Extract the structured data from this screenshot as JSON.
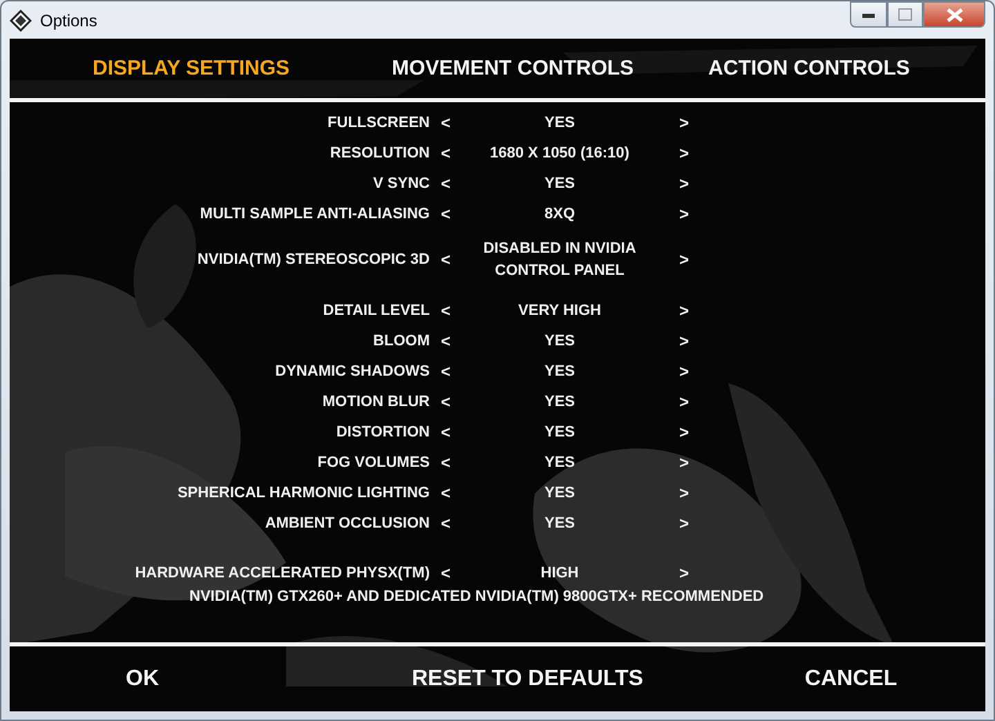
{
  "window": {
    "title": "Options"
  },
  "tabs": [
    {
      "label": "DISPLAY SETTINGS",
      "selected": true
    },
    {
      "label": "MOVEMENT CONTROLS",
      "selected": false
    },
    {
      "label": "ACTION CONTROLS",
      "selected": false
    }
  ],
  "settings": [
    {
      "label": "FULLSCREEN",
      "prev": "<",
      "value": "YES",
      "next": ">"
    },
    {
      "label": "RESOLUTION",
      "prev": "<",
      "value": "1680 X 1050 (16:10)",
      "next": ">"
    },
    {
      "label": "V SYNC",
      "prev": "<",
      "value": "YES",
      "next": ">"
    },
    {
      "label": "MULTI SAMPLE ANTI-ALIASING",
      "prev": "<",
      "value": "8XQ",
      "next": ">"
    },
    {
      "label": "NVIDIA(TM) STEREOSCOPIC 3D",
      "prev": "<",
      "value": "DISABLED IN NVIDIA CONTROL PANEL",
      "next": ">"
    },
    {
      "label": "DETAIL LEVEL",
      "prev": "<",
      "value": "VERY HIGH",
      "next": ">"
    },
    {
      "label": "BLOOM",
      "prev": "<",
      "value": "YES",
      "next": ">"
    },
    {
      "label": "DYNAMIC SHADOWS",
      "prev": "<",
      "value": "YES",
      "next": ">"
    },
    {
      "label": "MOTION BLUR",
      "prev": "<",
      "value": "YES",
      "next": ">"
    },
    {
      "label": "DISTORTION",
      "prev": "<",
      "value": "YES",
      "next": ">"
    },
    {
      "label": "FOG VOLUMES",
      "prev": "<",
      "value": "YES",
      "next": ">"
    },
    {
      "label": "SPHERICAL HARMONIC LIGHTING",
      "prev": "<",
      "value": "YES",
      "next": ">"
    },
    {
      "label": "AMBIENT OCCLUSION",
      "prev": "<",
      "value": "YES",
      "next": ">"
    }
  ],
  "physx": {
    "label": "HARDWARE ACCELERATED PHYSX(TM)",
    "prev": "<",
    "value": "HIGH",
    "next": ">",
    "note": "NVIDIA(TM) GTX260+ AND DEDICATED NVIDIA(TM) 9800GTX+ RECOMMENDED"
  },
  "buttons": [
    "OK",
    "RESET TO DEFAULTS",
    "CANCEL"
  ]
}
